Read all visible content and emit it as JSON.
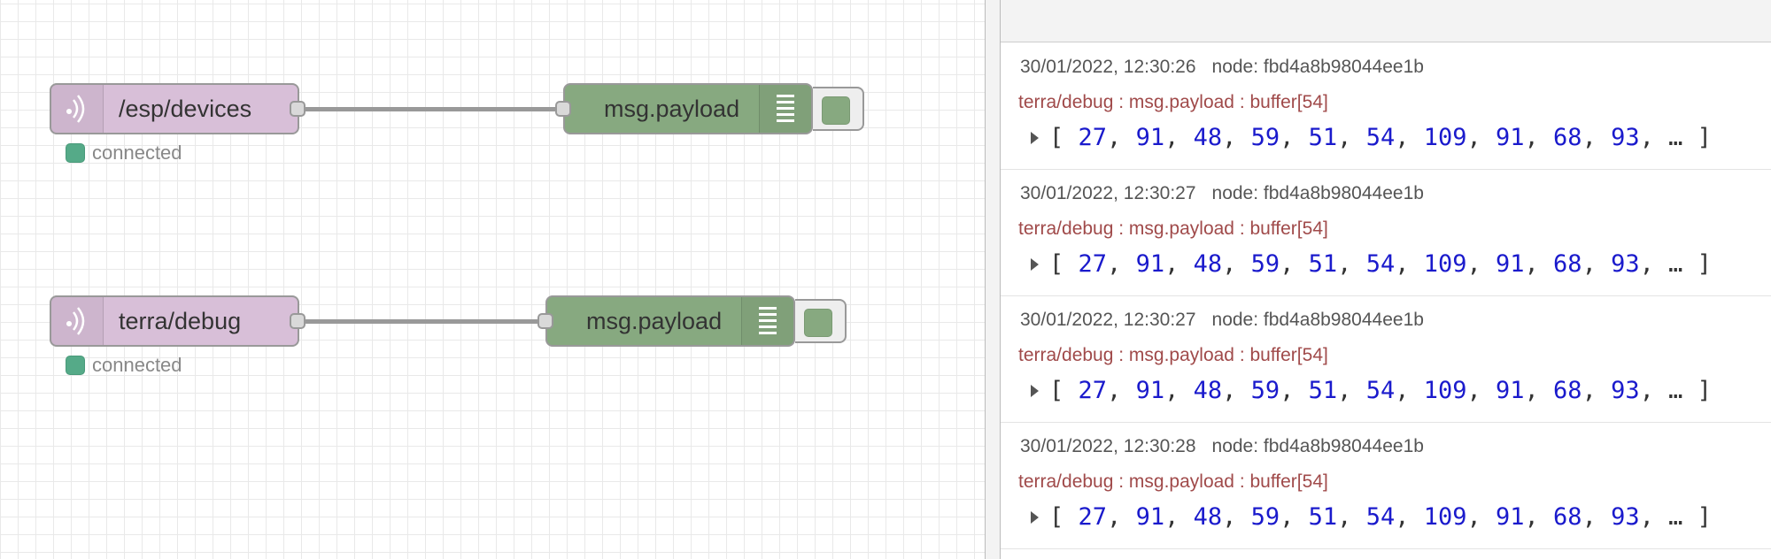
{
  "flow": {
    "nodes": [
      {
        "type": "mqtt in",
        "label": "/esp/devices",
        "status": "connected"
      },
      {
        "type": "debug",
        "label": "msg.payload"
      },
      {
        "type": "mqtt in",
        "label": "terra/debug",
        "status": "connected"
      },
      {
        "type": "debug",
        "label": "msg.payload"
      }
    ]
  },
  "colors": {
    "mqtt_node": "#d8bfd8",
    "debug_node": "#87a980",
    "status_connected": "#55aa88",
    "topic_text": "#a04a4a",
    "number_text": "#1a1acc"
  },
  "icons": {
    "mqtt": "signal-waves-icon",
    "debug": "list-lines-icon",
    "expand": "caret-right-icon"
  },
  "debug_sidebar": {
    "messages": [
      {
        "timestamp": "30/01/2022, 12:30:26",
        "node": "node: fbd4a8b98044ee1b",
        "topic": "terra/debug : msg.payload : buffer[54]",
        "open": "[",
        "values": [
          "27",
          "91",
          "48",
          "59",
          "51",
          "54",
          "109",
          "91",
          "68",
          "93"
        ],
        "ellipsis": "…",
        "close": "]"
      },
      {
        "timestamp": "30/01/2022, 12:30:27",
        "node": "node: fbd4a8b98044ee1b",
        "topic": "terra/debug : msg.payload : buffer[54]",
        "open": "[",
        "values": [
          "27",
          "91",
          "48",
          "59",
          "51",
          "54",
          "109",
          "91",
          "68",
          "93"
        ],
        "ellipsis": "…",
        "close": "]"
      },
      {
        "timestamp": "30/01/2022, 12:30:27",
        "node": "node: fbd4a8b98044ee1b",
        "topic": "terra/debug : msg.payload : buffer[54]",
        "open": "[",
        "values": [
          "27",
          "91",
          "48",
          "59",
          "51",
          "54",
          "109",
          "91",
          "68",
          "93"
        ],
        "ellipsis": "…",
        "close": "]"
      },
      {
        "timestamp": "30/01/2022, 12:30:28",
        "node": "node: fbd4a8b98044ee1b",
        "topic": "terra/debug : msg.payload : buffer[54]",
        "open": "[",
        "values": [
          "27",
          "91",
          "48",
          "59",
          "51",
          "54",
          "109",
          "91",
          "68",
          "93"
        ],
        "ellipsis": "…",
        "close": "]"
      }
    ]
  }
}
